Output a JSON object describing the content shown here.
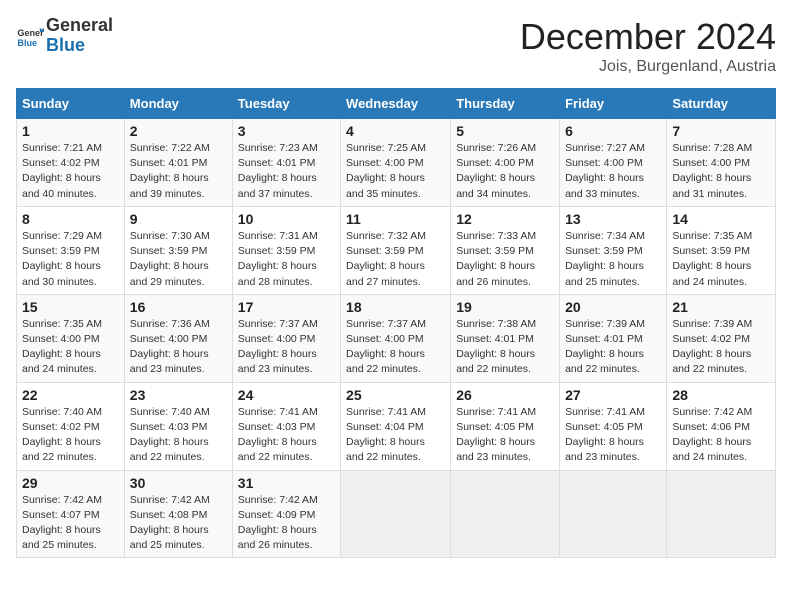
{
  "header": {
    "logo_general": "General",
    "logo_blue": "Blue",
    "month_title": "December 2024",
    "location": "Jois, Burgenland, Austria"
  },
  "weekdays": [
    "Sunday",
    "Monday",
    "Tuesday",
    "Wednesday",
    "Thursday",
    "Friday",
    "Saturday"
  ],
  "weeks": [
    [
      {
        "day": "1",
        "sunrise": "Sunrise: 7:21 AM",
        "sunset": "Sunset: 4:02 PM",
        "daylight": "Daylight: 8 hours and 40 minutes."
      },
      {
        "day": "2",
        "sunrise": "Sunrise: 7:22 AM",
        "sunset": "Sunset: 4:01 PM",
        "daylight": "Daylight: 8 hours and 39 minutes."
      },
      {
        "day": "3",
        "sunrise": "Sunrise: 7:23 AM",
        "sunset": "Sunset: 4:01 PM",
        "daylight": "Daylight: 8 hours and 37 minutes."
      },
      {
        "day": "4",
        "sunrise": "Sunrise: 7:25 AM",
        "sunset": "Sunset: 4:00 PM",
        "daylight": "Daylight: 8 hours and 35 minutes."
      },
      {
        "day": "5",
        "sunrise": "Sunrise: 7:26 AM",
        "sunset": "Sunset: 4:00 PM",
        "daylight": "Daylight: 8 hours and 34 minutes."
      },
      {
        "day": "6",
        "sunrise": "Sunrise: 7:27 AM",
        "sunset": "Sunset: 4:00 PM",
        "daylight": "Daylight: 8 hours and 33 minutes."
      },
      {
        "day": "7",
        "sunrise": "Sunrise: 7:28 AM",
        "sunset": "Sunset: 4:00 PM",
        "daylight": "Daylight: 8 hours and 31 minutes."
      }
    ],
    [
      {
        "day": "8",
        "sunrise": "Sunrise: 7:29 AM",
        "sunset": "Sunset: 3:59 PM",
        "daylight": "Daylight: 8 hours and 30 minutes."
      },
      {
        "day": "9",
        "sunrise": "Sunrise: 7:30 AM",
        "sunset": "Sunset: 3:59 PM",
        "daylight": "Daylight: 8 hours and 29 minutes."
      },
      {
        "day": "10",
        "sunrise": "Sunrise: 7:31 AM",
        "sunset": "Sunset: 3:59 PM",
        "daylight": "Daylight: 8 hours and 28 minutes."
      },
      {
        "day": "11",
        "sunrise": "Sunrise: 7:32 AM",
        "sunset": "Sunset: 3:59 PM",
        "daylight": "Daylight: 8 hours and 27 minutes."
      },
      {
        "day": "12",
        "sunrise": "Sunrise: 7:33 AM",
        "sunset": "Sunset: 3:59 PM",
        "daylight": "Daylight: 8 hours and 26 minutes."
      },
      {
        "day": "13",
        "sunrise": "Sunrise: 7:34 AM",
        "sunset": "Sunset: 3:59 PM",
        "daylight": "Daylight: 8 hours and 25 minutes."
      },
      {
        "day": "14",
        "sunrise": "Sunrise: 7:35 AM",
        "sunset": "Sunset: 3:59 PM",
        "daylight": "Daylight: 8 hours and 24 minutes."
      }
    ],
    [
      {
        "day": "15",
        "sunrise": "Sunrise: 7:35 AM",
        "sunset": "Sunset: 4:00 PM",
        "daylight": "Daylight: 8 hours and 24 minutes."
      },
      {
        "day": "16",
        "sunrise": "Sunrise: 7:36 AM",
        "sunset": "Sunset: 4:00 PM",
        "daylight": "Daylight: 8 hours and 23 minutes."
      },
      {
        "day": "17",
        "sunrise": "Sunrise: 7:37 AM",
        "sunset": "Sunset: 4:00 PM",
        "daylight": "Daylight: 8 hours and 23 minutes."
      },
      {
        "day": "18",
        "sunrise": "Sunrise: 7:37 AM",
        "sunset": "Sunset: 4:00 PM",
        "daylight": "Daylight: 8 hours and 22 minutes."
      },
      {
        "day": "19",
        "sunrise": "Sunrise: 7:38 AM",
        "sunset": "Sunset: 4:01 PM",
        "daylight": "Daylight: 8 hours and 22 minutes."
      },
      {
        "day": "20",
        "sunrise": "Sunrise: 7:39 AM",
        "sunset": "Sunset: 4:01 PM",
        "daylight": "Daylight: 8 hours and 22 minutes."
      },
      {
        "day": "21",
        "sunrise": "Sunrise: 7:39 AM",
        "sunset": "Sunset: 4:02 PM",
        "daylight": "Daylight: 8 hours and 22 minutes."
      }
    ],
    [
      {
        "day": "22",
        "sunrise": "Sunrise: 7:40 AM",
        "sunset": "Sunset: 4:02 PM",
        "daylight": "Daylight: 8 hours and 22 minutes."
      },
      {
        "day": "23",
        "sunrise": "Sunrise: 7:40 AM",
        "sunset": "Sunset: 4:03 PM",
        "daylight": "Daylight: 8 hours and 22 minutes."
      },
      {
        "day": "24",
        "sunrise": "Sunrise: 7:41 AM",
        "sunset": "Sunset: 4:03 PM",
        "daylight": "Daylight: 8 hours and 22 minutes."
      },
      {
        "day": "25",
        "sunrise": "Sunrise: 7:41 AM",
        "sunset": "Sunset: 4:04 PM",
        "daylight": "Daylight: 8 hours and 22 minutes."
      },
      {
        "day": "26",
        "sunrise": "Sunrise: 7:41 AM",
        "sunset": "Sunset: 4:05 PM",
        "daylight": "Daylight: 8 hours and 23 minutes."
      },
      {
        "day": "27",
        "sunrise": "Sunrise: 7:41 AM",
        "sunset": "Sunset: 4:05 PM",
        "daylight": "Daylight: 8 hours and 23 minutes."
      },
      {
        "day": "28",
        "sunrise": "Sunrise: 7:42 AM",
        "sunset": "Sunset: 4:06 PM",
        "daylight": "Daylight: 8 hours and 24 minutes."
      }
    ],
    [
      {
        "day": "29",
        "sunrise": "Sunrise: 7:42 AM",
        "sunset": "Sunset: 4:07 PM",
        "daylight": "Daylight: 8 hours and 25 minutes."
      },
      {
        "day": "30",
        "sunrise": "Sunrise: 7:42 AM",
        "sunset": "Sunset: 4:08 PM",
        "daylight": "Daylight: 8 hours and 25 minutes."
      },
      {
        "day": "31",
        "sunrise": "Sunrise: 7:42 AM",
        "sunset": "Sunset: 4:09 PM",
        "daylight": "Daylight: 8 hours and 26 minutes."
      },
      null,
      null,
      null,
      null
    ]
  ]
}
